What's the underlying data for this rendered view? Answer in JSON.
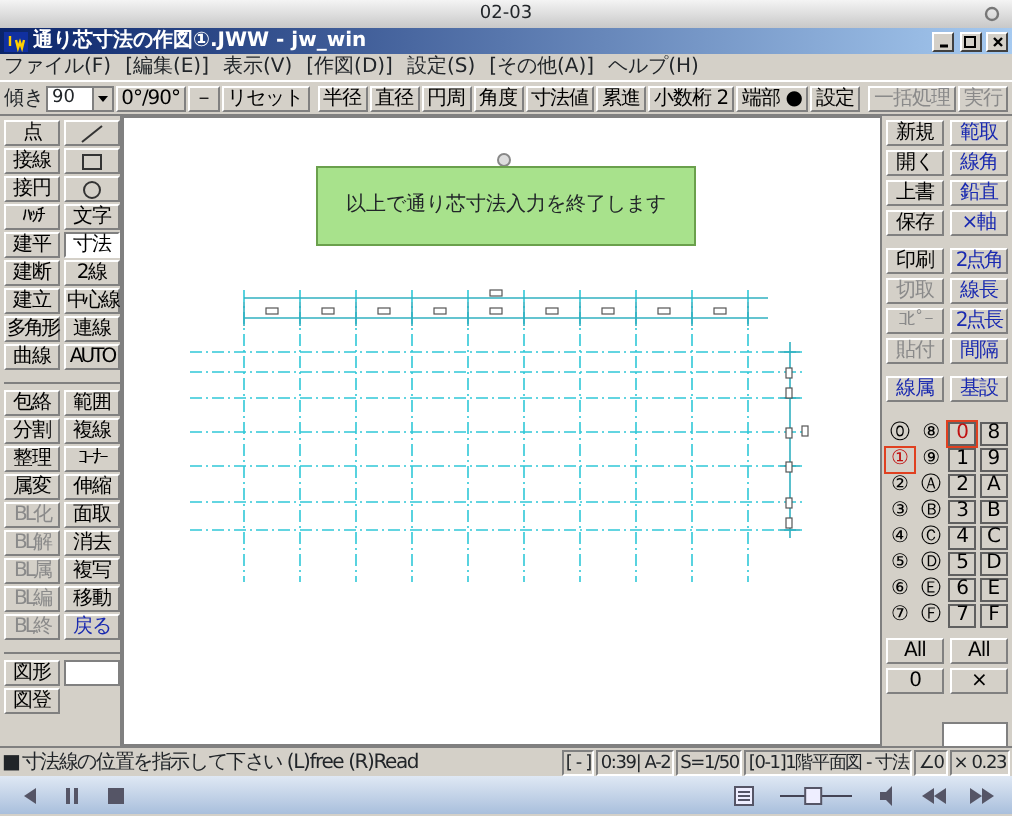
{
  "player": {
    "title": "02-03",
    "volume": {
      "level": 0.45
    }
  },
  "window": {
    "title": "通り芯寸法の作図①.JWW - jw_win"
  },
  "menu": [
    "ファイル(F)",
    "[編集(E)]",
    "表示(V)",
    "[作図(D)]",
    "設定(S)",
    "[その他(A)]",
    "ヘルプ(H)"
  ],
  "toolbar": {
    "tilt_label": "傾き",
    "tilt_value": "90",
    "buttons": [
      {
        "label": "0°/90°",
        "disabled": false
      },
      {
        "label": "－",
        "disabled": false
      },
      {
        "label": "リセット",
        "disabled": false
      },
      {
        "label": "半径",
        "disabled": false
      },
      {
        "label": "直径",
        "disabled": false
      },
      {
        "label": "円周",
        "disabled": false
      },
      {
        "label": "角度",
        "disabled": false
      },
      {
        "label": "寸法値",
        "disabled": false
      },
      {
        "label": "累進",
        "disabled": false
      },
      {
        "label": "小数桁 2",
        "disabled": false
      },
      {
        "label": "端部 ●",
        "disabled": false
      },
      {
        "label": "設定",
        "disabled": false
      },
      {
        "label": "一括処理",
        "disabled": true
      },
      {
        "label": "実行",
        "disabled": true
      }
    ]
  },
  "left_tools": [
    [
      {
        "kind": "text",
        "label": "点",
        "selected": false,
        "disabled": false,
        "accent": false
      },
      {
        "kind": "line",
        "selected": false,
        "disabled": false,
        "accent": false
      },
      {
        "kind": "text",
        "label": "接線",
        "selected": false,
        "disabled": false,
        "accent": false
      },
      {
        "kind": "rect",
        "selected": false,
        "disabled": false,
        "accent": false
      },
      {
        "kind": "text",
        "label": "接円",
        "selected": false,
        "disabled": false,
        "accent": false
      },
      {
        "kind": "circle",
        "selected": false,
        "disabled": false,
        "accent": false
      },
      {
        "kind": "text",
        "label": "ﾊｯﾁ",
        "selected": false,
        "disabled": false,
        "accent": false
      },
      {
        "kind": "text",
        "label": "文字",
        "selected": false,
        "disabled": false,
        "accent": false
      },
      {
        "kind": "text",
        "label": "建平",
        "selected": false,
        "disabled": false,
        "accent": false
      },
      {
        "kind": "text",
        "label": "寸法",
        "selected": true,
        "disabled": false,
        "accent": false
      },
      {
        "kind": "text",
        "label": "建断",
        "selected": false,
        "disabled": false,
        "accent": false
      },
      {
        "kind": "text",
        "label": "2線",
        "selected": false,
        "disabled": false,
        "accent": false
      },
      {
        "kind": "text",
        "label": "建立",
        "selected": false,
        "disabled": false,
        "accent": false
      },
      {
        "kind": "text",
        "label": "中心線",
        "selected": false,
        "disabled": false,
        "accent": false
      },
      {
        "kind": "text",
        "label": "多角形",
        "selected": false,
        "disabled": false,
        "accent": false
      },
      {
        "kind": "text",
        "label": "連線",
        "selected": false,
        "disabled": false,
        "accent": false
      },
      {
        "kind": "text",
        "label": "曲線",
        "selected": false,
        "disabled": false,
        "accent": false
      },
      {
        "kind": "text",
        "label": "AUTO",
        "selected": false,
        "disabled": false,
        "accent": false
      }
    ],
    [
      {
        "kind": "text",
        "label": "包絡",
        "selected": false,
        "disabled": false,
        "accent": false
      },
      {
        "kind": "text",
        "label": "範囲",
        "selected": false,
        "disabled": false,
        "accent": false
      },
      {
        "kind": "text",
        "label": "分割",
        "selected": false,
        "disabled": false,
        "accent": false
      },
      {
        "kind": "text",
        "label": "複線",
        "selected": false,
        "disabled": false,
        "accent": false
      },
      {
        "kind": "text",
        "label": "整理",
        "selected": false,
        "disabled": false,
        "accent": false
      },
      {
        "kind": "text",
        "label": "ｺｰﾅｰ",
        "selected": false,
        "disabled": false,
        "accent": false
      },
      {
        "kind": "text",
        "label": "属変",
        "selected": false,
        "disabled": false,
        "accent": false
      },
      {
        "kind": "text",
        "label": "伸縮",
        "selected": false,
        "disabled": false,
        "accent": false
      },
      {
        "kind": "text",
        "label": "BL化",
        "selected": false,
        "disabled": true,
        "accent": false
      },
      {
        "kind": "text",
        "label": "面取",
        "selected": false,
        "disabled": false,
        "accent": false
      },
      {
        "kind": "text",
        "label": "BL解",
        "selected": false,
        "disabled": true,
        "accent": false
      },
      {
        "kind": "text",
        "label": "消去",
        "selected": false,
        "disabled": false,
        "accent": false
      },
      {
        "kind": "text",
        "label": "BL属",
        "selected": false,
        "disabled": true,
        "accent": false
      },
      {
        "kind": "text",
        "label": "複写",
        "selected": false,
        "disabled": false,
        "accent": false
      },
      {
        "kind": "text",
        "label": "BL編",
        "selected": false,
        "disabled": true,
        "accent": false
      },
      {
        "kind": "text",
        "label": "移動",
        "selected": false,
        "disabled": false,
        "accent": false
      },
      {
        "kind": "text",
        "label": "BL終",
        "selected": false,
        "disabled": true,
        "accent": false
      },
      {
        "kind": "text",
        "label": "戻る",
        "selected": false,
        "disabled": false,
        "accent": true
      }
    ],
    [
      {
        "kind": "text",
        "label": "図形",
        "selected": false,
        "disabled": false,
        "accent": false
      },
      {
        "kind": "blank",
        "selected": false,
        "disabled": false
      },
      {
        "kind": "text",
        "label": "図登",
        "selected": false,
        "disabled": false,
        "accent": false
      }
    ]
  ],
  "canvas": {
    "message": "以上で通り芯寸法入力を終了します"
  },
  "right_tools": [
    {
      "label": "新規",
      "disabled": false,
      "accent": false
    },
    {
      "label": "範取",
      "disabled": false,
      "accent": true
    },
    {
      "label": "開く",
      "disabled": false,
      "accent": false
    },
    {
      "label": "線角",
      "disabled": false,
      "accent": true
    },
    {
      "label": "上書",
      "disabled": false,
      "accent": false
    },
    {
      "label": "鉛直",
      "disabled": false,
      "accent": true
    },
    {
      "label": "保存",
      "disabled": false,
      "accent": false
    },
    {
      "label": "×軸",
      "disabled": false,
      "accent": true
    },
    {
      "label": "印刷",
      "disabled": false,
      "accent": false
    },
    {
      "label": "2点角",
      "disabled": false,
      "accent": true
    },
    {
      "label": "切取",
      "disabled": true,
      "accent": false
    },
    {
      "label": "線長",
      "disabled": false,
      "accent": true
    },
    {
      "label": "ｺﾋﾟｰ",
      "disabled": true,
      "accent": false
    },
    {
      "label": "2点長",
      "disabled": false,
      "accent": true
    },
    {
      "label": "貼付",
      "disabled": true,
      "accent": false
    },
    {
      "label": "間隔",
      "disabled": false,
      "accent": true
    },
    {
      "label": "線属",
      "disabled": false,
      "accent": true
    },
    {
      "label": "基設",
      "disabled": false,
      "accent": true
    }
  ],
  "layers": [
    {
      "kind": "group",
      "label": "⓪",
      "selected": false
    },
    {
      "kind": "group",
      "label": "⑧",
      "selected": false
    },
    {
      "kind": "layer",
      "label": "0",
      "selected": true
    },
    {
      "kind": "layer",
      "label": "8",
      "selected": false
    },
    {
      "kind": "group",
      "label": "①",
      "selected": true
    },
    {
      "kind": "group",
      "label": "⑨",
      "selected": false
    },
    {
      "kind": "layer",
      "label": "1",
      "selected": false
    },
    {
      "kind": "layer",
      "label": "9",
      "selected": false
    },
    {
      "kind": "group",
      "label": "②",
      "selected": false
    },
    {
      "kind": "group",
      "label": "Ⓐ",
      "selected": false
    },
    {
      "kind": "layer",
      "label": "2",
      "selected": false
    },
    {
      "kind": "layer",
      "label": "A",
      "selected": false
    },
    {
      "kind": "group",
      "label": "③",
      "selected": false
    },
    {
      "kind": "group",
      "label": "Ⓑ",
      "selected": false
    },
    {
      "kind": "layer",
      "label": "3",
      "selected": false
    },
    {
      "kind": "layer",
      "label": "B",
      "selected": false
    },
    {
      "kind": "group",
      "label": "④",
      "selected": false
    },
    {
      "kind": "group",
      "label": "Ⓒ",
      "selected": false
    },
    {
      "kind": "layer",
      "label": "4",
      "selected": false
    },
    {
      "kind": "layer",
      "label": "C",
      "selected": false
    },
    {
      "kind": "group",
      "label": "⑤",
      "selected": false
    },
    {
      "kind": "group",
      "label": "Ⓓ",
      "selected": false
    },
    {
      "kind": "layer",
      "label": "5",
      "selected": false
    },
    {
      "kind": "layer",
      "label": "D",
      "selected": false
    },
    {
      "kind": "group",
      "label": "⑥",
      "selected": false
    },
    {
      "kind": "group",
      "label": "Ⓔ",
      "selected": false
    },
    {
      "kind": "layer",
      "label": "6",
      "selected": false
    },
    {
      "kind": "layer",
      "label": "E",
      "selected": false
    },
    {
      "kind": "group",
      "label": "⑦",
      "selected": false
    },
    {
      "kind": "group",
      "label": "Ⓕ",
      "selected": false
    },
    {
      "kind": "layer",
      "label": "7",
      "selected": false
    },
    {
      "kind": "layer",
      "label": "F",
      "selected": false
    }
  ],
  "layer_actions": [
    "All",
    "All",
    "0",
    "×"
  ],
  "status_bar": {
    "mark": "■",
    "message": "寸法線の位置を指示して下さい (L)free (R)Read",
    "fields": [
      "[ - ]",
      "0:39| A-2",
      "S=1/50",
      "[0-1]1階平面図 - 寸法",
      "∠0",
      "× 0.23"
    ]
  }
}
